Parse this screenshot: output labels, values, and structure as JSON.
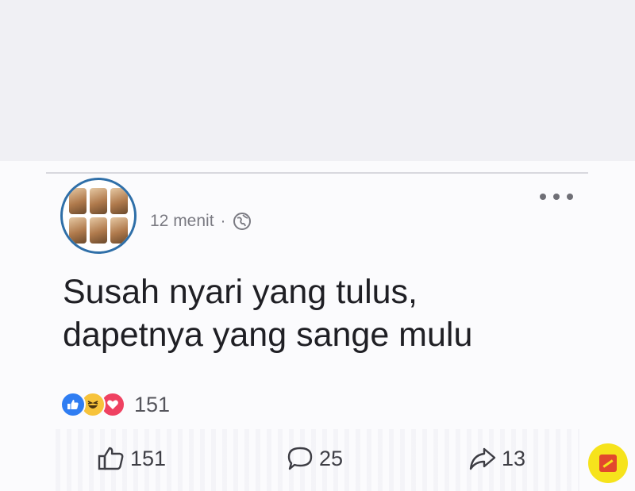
{
  "post": {
    "time": "12 menit",
    "separator": "·",
    "privacy_icon": "globe-icon",
    "more_icon": "more-options-icon",
    "text_line1": "Susah nyari yang tulus,",
    "text_line2": "dapetnya yang sange mulu"
  },
  "reactions": {
    "icons": [
      "like-reaction-icon",
      "haha-reaction-icon",
      "love-reaction-icon"
    ],
    "count": "151"
  },
  "actions": {
    "likes": "151",
    "comments": "25",
    "shares": "13"
  },
  "colors": {
    "like_blue": "#2f7df2",
    "haha_yellow": "#f7c33b",
    "love_red": "#ef4161",
    "avatar_ring": "#2f6fa8",
    "badge_yellow": "#f6e31c"
  }
}
